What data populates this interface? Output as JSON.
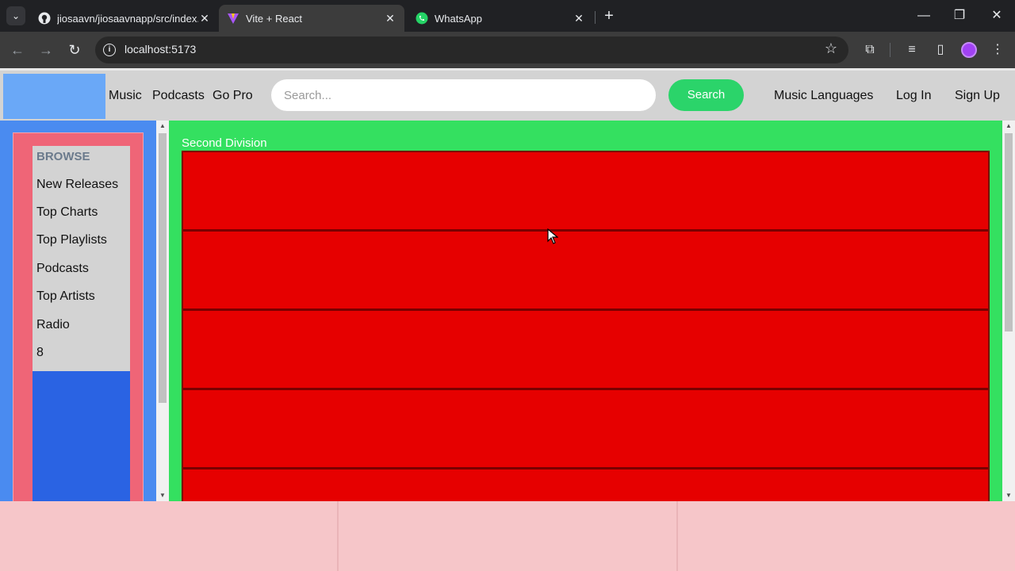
{
  "browser": {
    "tabs": [
      {
        "title": "jiosaavn/jiosaavnapp/src/index.",
        "icon": "github-icon"
      },
      {
        "title": "Vite + React",
        "icon": "vite-icon"
      },
      {
        "title": "WhatsApp",
        "icon": "whatsapp-icon"
      }
    ],
    "url": "localhost:5173"
  },
  "header": {
    "nav": [
      "Music",
      "Podcasts",
      "Go Pro"
    ],
    "search_placeholder": "Search...",
    "search_button": "Search",
    "right": [
      "Music Languages",
      "Log In",
      "Sign Up"
    ]
  },
  "sidebar": {
    "heading": "BROWSE",
    "items": [
      "New Releases",
      "Top Charts",
      "Top Playlists",
      "Podcasts",
      "Top Artists",
      "Radio",
      "8"
    ]
  },
  "main": {
    "title": "Second Division"
  },
  "colors": {
    "header_bg": "#d3d3d3",
    "logo_bg": "#6aa8f7",
    "search_button": "#2bd46a",
    "sidebar_bg": "#4a8bf0",
    "sidebar_panel": "#ef6577",
    "main_bg": "#34e060",
    "cell_bg": "#e60000",
    "footer_bg": "#f6c6c9"
  }
}
